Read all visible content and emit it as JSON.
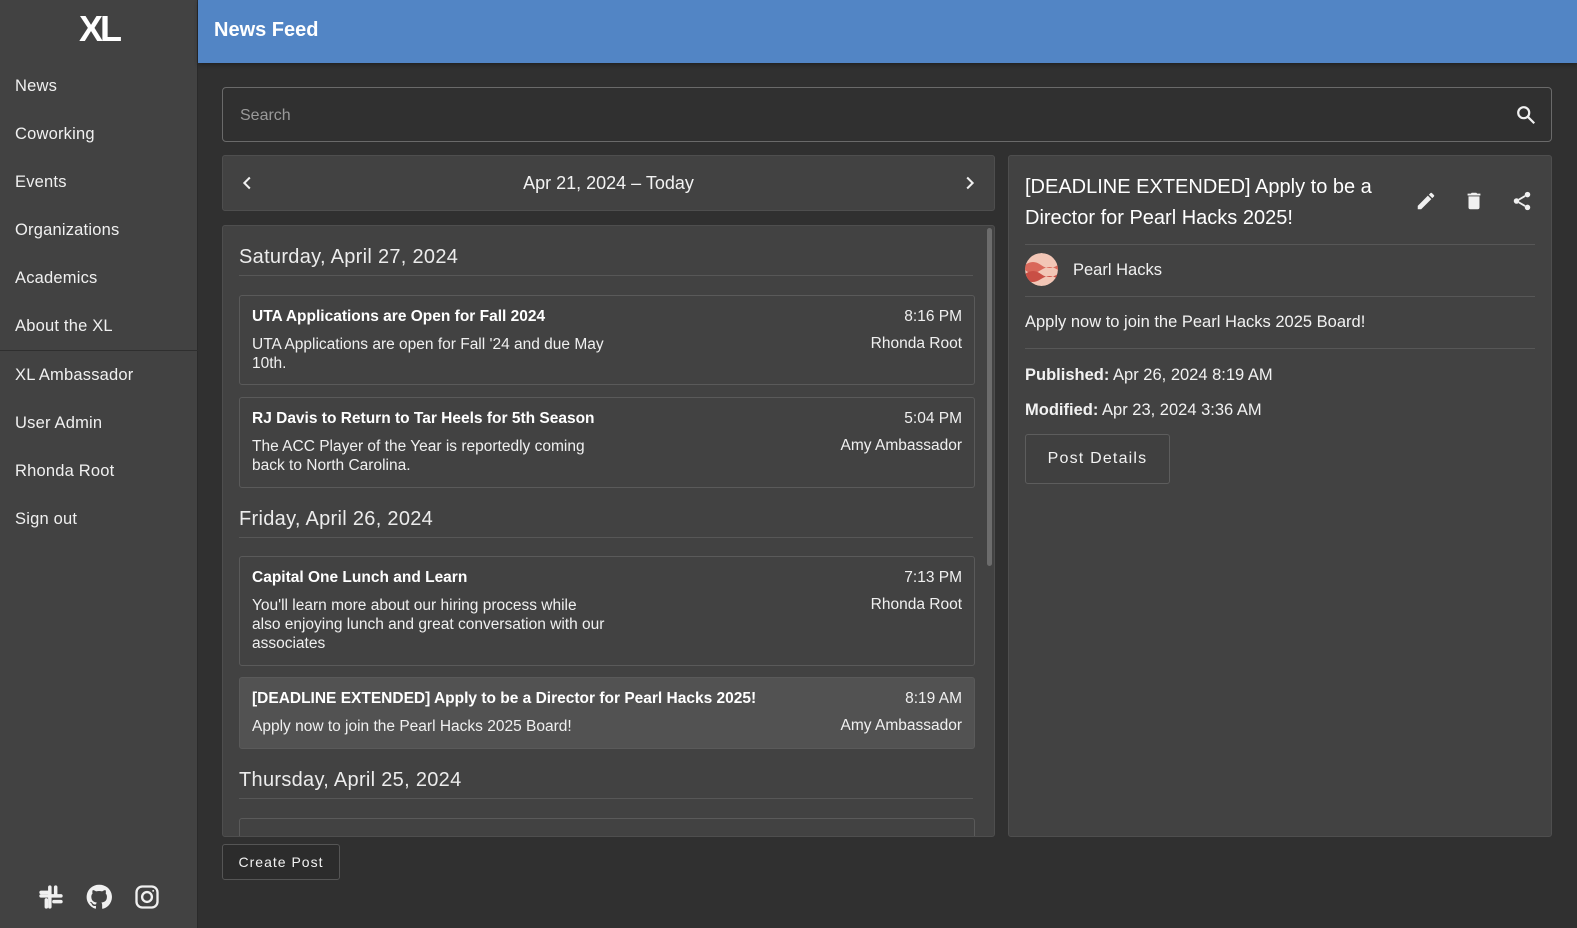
{
  "app": {
    "logo_text": "XL",
    "page_title": "News Feed"
  },
  "sidebar": {
    "items": [
      {
        "label": "News"
      },
      {
        "label": "Coworking"
      },
      {
        "label": "Events"
      },
      {
        "label": "Organizations"
      },
      {
        "label": "Academics"
      },
      {
        "label": "About the XL"
      }
    ],
    "secondary_items": [
      {
        "label": "XL Ambassador"
      },
      {
        "label": "User Admin"
      },
      {
        "label": "Rhonda Root"
      },
      {
        "label": "Sign out"
      }
    ],
    "social_icons": [
      "slack-icon",
      "github-icon",
      "instagram-icon"
    ]
  },
  "search": {
    "placeholder": "Search",
    "value": ""
  },
  "date_nav": {
    "range_label": "Apr 21, 2024 – Today"
  },
  "feed": {
    "days": [
      {
        "label": "Saturday, April 27, 2024",
        "posts": [
          {
            "title": "UTA Applications are Open for Fall 2024",
            "body": "UTA Applications are open for Fall '24 and due May 10th.",
            "time": "8:16 PM",
            "author": "Rhonda Root"
          },
          {
            "title": "RJ Davis to Return to Tar Heels for 5th Season",
            "body": "The ACC Player of the Year is reportedly coming back to North Carolina.",
            "time": "5:04 PM",
            "author": "Amy Ambassador"
          }
        ]
      },
      {
        "label": "Friday, April 26, 2024",
        "posts": [
          {
            "title": "Capital One Lunch and Learn",
            "body": "You'll learn more about our hiring process while also enjoying lunch and great conversation with our associates",
            "time": "7:13 PM",
            "author": "Rhonda Root"
          },
          {
            "title": "[DEADLINE EXTENDED] Apply to be a Director for Pearl Hacks 2025!",
            "body": "Apply now to join the Pearl Hacks 2025 Board!",
            "time": "8:19 AM",
            "author": "Amy Ambassador",
            "selected": true
          }
        ]
      },
      {
        "label": "Thursday, April 25, 2024",
        "posts": []
      }
    ]
  },
  "detail": {
    "title": "[DEADLINE EXTENDED] Apply to be a Director for Pearl Hacks 2025!",
    "organization": "Pearl Hacks",
    "summary": "Apply now to join the Pearl Hacks 2025 Board!",
    "published_label": "Published:",
    "published_value": "Apr 26, 2024 8:19 AM",
    "modified_label": "Modified:",
    "modified_value": "Apr 23, 2024 3:36 AM",
    "details_button": "Post Details",
    "actions": [
      "edit-icon",
      "delete-icon",
      "share-icon"
    ]
  },
  "create_post_label": "Create Post",
  "colors": {
    "header": "#5285c5",
    "sidebar": "#424242",
    "background": "#303030",
    "card": "#424242",
    "selected_card": "#525252"
  }
}
